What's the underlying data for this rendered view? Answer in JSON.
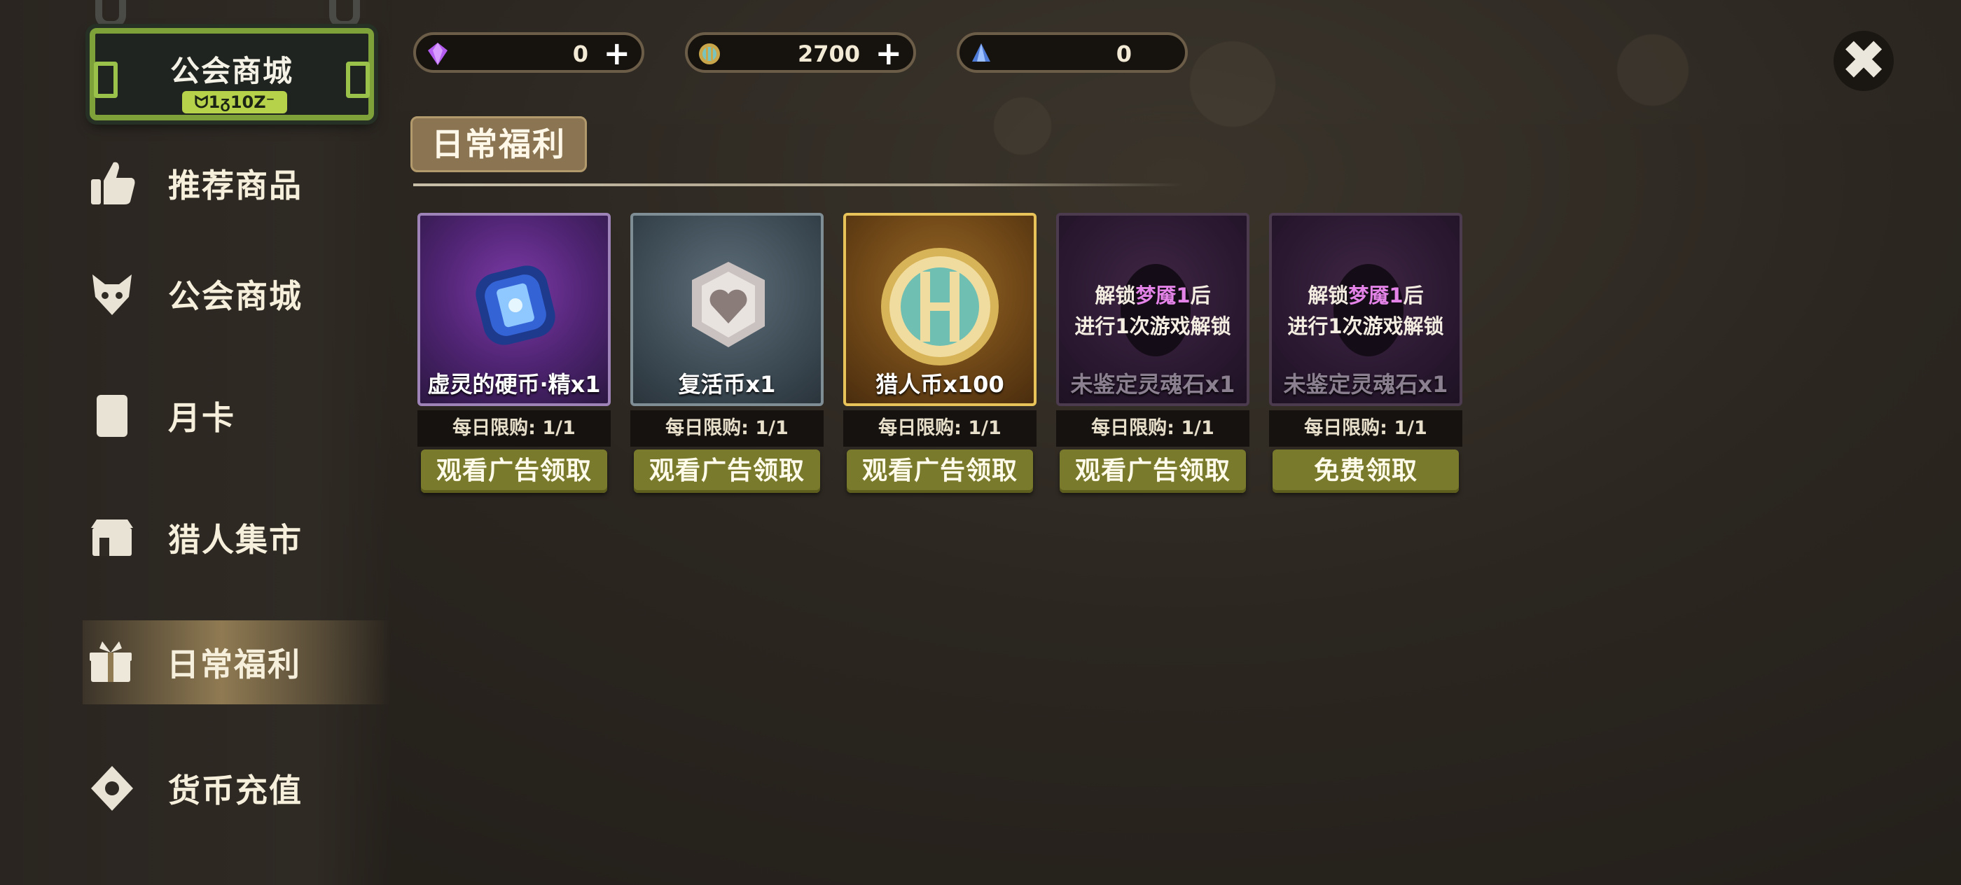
{
  "sidebar": {
    "sign_title": "公会商城",
    "sign_badge": "ᗢ1ᵹ10Z⁻",
    "items": [
      {
        "label": "推荐商品",
        "icon": "thumbs-up-icon"
      },
      {
        "label": "公会商城",
        "icon": "fox-mask-icon"
      },
      {
        "label": "月卡",
        "icon": "card-icon"
      },
      {
        "label": "猎人集市",
        "icon": "shop-stall-icon"
      },
      {
        "label": "日常福利",
        "icon": "gift-box-icon",
        "active": true
      },
      {
        "label": "货币充值",
        "icon": "diamond-coin-icon"
      }
    ]
  },
  "currencies": [
    {
      "icon": "purple-gem-icon",
      "value": "0",
      "has_plus": true
    },
    {
      "icon": "hunter-coin-icon",
      "value": "2700",
      "has_plus": true
    },
    {
      "icon": "blue-crystal-icon",
      "value": "0",
      "has_plus": false
    }
  ],
  "close_icon": "close-icon",
  "section": {
    "title": "日常福利"
  },
  "cards": [
    {
      "name": "虚灵的硬币·精x1",
      "limit": "每日限购: 1/1",
      "button": "观看广告领取",
      "style": "purple",
      "icon": "blue-rune-coin-icon"
    },
    {
      "name": "复活币x1",
      "limit": "每日限购: 1/1",
      "button": "观看广告领取",
      "style": "slate",
      "icon": "heart-coin-icon"
    },
    {
      "name": "猎人币x100",
      "limit": "每日限购: 1/1",
      "button": "观看广告领取",
      "style": "gold",
      "icon": "hunter-coin-icon"
    },
    {
      "name": "未鉴定灵魂石x1",
      "limit": "每日限购: 1/1",
      "button": "观看广告领取",
      "style": "dark",
      "locked": true,
      "lock_line1_a": "解锁",
      "lock_line1_hl": "梦魇1",
      "lock_line1_b": "后",
      "lock_line2": "进行1次游戏解锁"
    },
    {
      "name": "未鉴定灵魂石x1",
      "limit": "每日限购: 1/1",
      "button": "免费领取",
      "style": "dark",
      "locked": true,
      "lock_line1_a": "解锁",
      "lock_line1_hl": "梦魇1",
      "lock_line1_b": "后",
      "lock_line2": "进行1次游戏解锁"
    }
  ],
  "colors": {
    "accent_gold": "#8a7452",
    "button_olive": "#7a7a2c",
    "sign_green": "#7fa13a",
    "highlight_pink": "#e483e8"
  }
}
